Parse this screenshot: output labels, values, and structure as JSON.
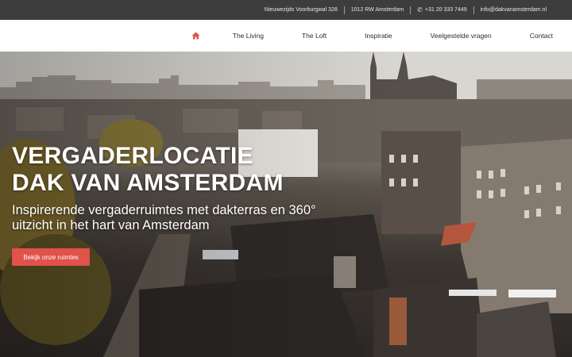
{
  "topbar": {
    "address": "Nieuwezijds Voorburgwal 328",
    "postcode": "1012 RW Amsterdam",
    "phone": "+31 20 333 7449",
    "email": "info@dakvanamsterdam.nl",
    "phone_icon": "phone-icon"
  },
  "nav": {
    "home_icon": "home-icon",
    "accent_color": "#e0524b",
    "items": [
      {
        "label": "The Living"
      },
      {
        "label": "The Loft"
      },
      {
        "label": "Inspiratie"
      },
      {
        "label": "Veelgestelde vragen"
      },
      {
        "label": "Contact"
      }
    ]
  },
  "hero": {
    "title_line1": "VERGADERLOCATIE",
    "title_line2": "DAK VAN AMSTERDAM",
    "subtitle_line1": "Inspirerende vergaderruimtes met dakterras en 360°",
    "subtitle_line2": "uitzicht in het hart van Amsterdam",
    "cta_label": "Bekijk onze ruimtes",
    "cta_color": "#e0524b"
  }
}
